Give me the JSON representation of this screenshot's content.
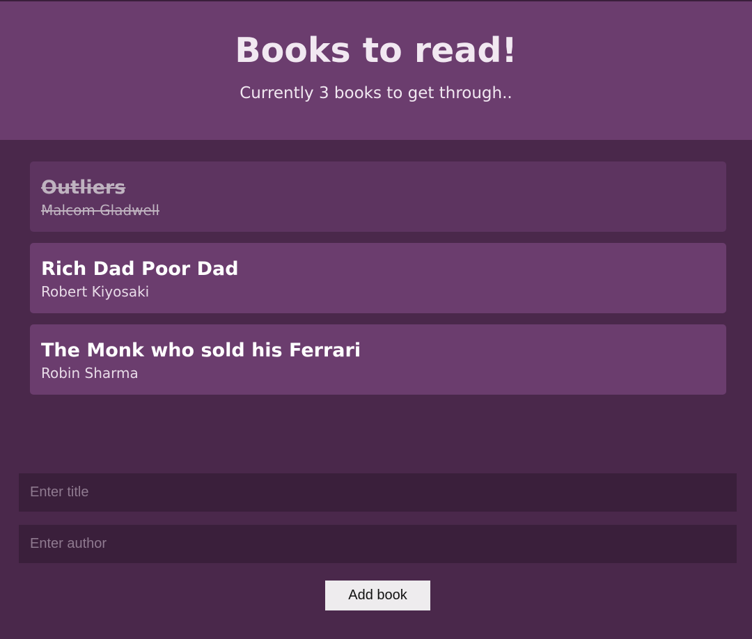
{
  "header": {
    "title": "Books to read!",
    "subtitle": "Currently 3 books to get through.."
  },
  "books": [
    {
      "title": "Outliers",
      "author": "Malcom Gladwell",
      "read": true
    },
    {
      "title": "Rich Dad Poor Dad",
      "author": "Robert Kiyosaki",
      "read": false
    },
    {
      "title": "The Monk who sold his Ferrari",
      "author": "Robin Sharma",
      "read": false
    }
  ],
  "form": {
    "title_placeholder": "Enter title",
    "title_value": "",
    "author_placeholder": "Enter author",
    "author_value": "",
    "submit_label": "Add book"
  },
  "colors": {
    "background": "#4a284b",
    "header": "#6b3d6e",
    "card": "#6b3d6e",
    "card_read": "#5d3460",
    "input": "#3a1f3b",
    "button": "#eeecee"
  }
}
